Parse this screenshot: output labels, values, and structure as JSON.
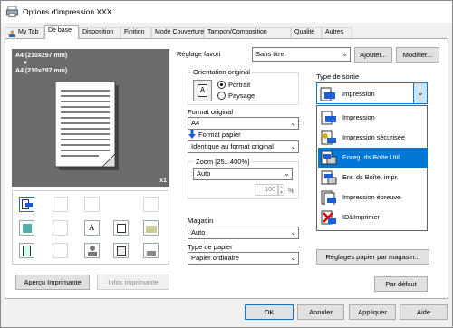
{
  "window": {
    "title": "Options d'impression XXX"
  },
  "tabs": [
    {
      "label": "My Tab"
    },
    {
      "label": "De base"
    },
    {
      "label": "Disposition"
    },
    {
      "label": "Finition"
    },
    {
      "label": "Mode Couverture"
    },
    {
      "label": "Tampon/Composition"
    },
    {
      "label": "Qualité"
    },
    {
      "label": "Autres"
    }
  ],
  "preview": {
    "paper_label_1": "A4 (210x297 mm)",
    "arrow_glyph": "▼",
    "paper_label_2": "A4 (210x297 mm)",
    "copies": "x1"
  },
  "bottom_left": {
    "printer_view_button": "Aperçu Imprimante",
    "printer_info_button": "Infos imprimante"
  },
  "favorites": {
    "label": "Réglage favori",
    "value": "Sans titre",
    "add_button": "Ajouter...",
    "edit_button": "Modifier..."
  },
  "orientation": {
    "title": "Orientation original",
    "portrait": "Portrait",
    "landscape": "Paysage",
    "selected": "Portrait"
  },
  "original_size": {
    "label": "Format original",
    "value": "A4"
  },
  "paper_size": {
    "label": "Format papier",
    "value": "Identique au format original"
  },
  "zoom": {
    "label": "Zoom [25...400%]",
    "mode_value": "Auto",
    "percent_value": "100",
    "unit": "%"
  },
  "paper_tray": {
    "label": "Magasin",
    "value": "Auto"
  },
  "paper_type": {
    "label": "Type de papier",
    "value": "Papier ordinaire"
  },
  "output_method": {
    "label": "Type de sortie",
    "value": "Impression",
    "options": [
      {
        "label": "Impression",
        "icon": "print-icon"
      },
      {
        "label": "Impression sécurisée",
        "icon": "secure-print-icon"
      },
      {
        "label": "Enreg. ds Boîte Util.",
        "icon": "save-to-box-icon"
      },
      {
        "label": "Enr. ds Boîte, impr.",
        "icon": "save-and-print-icon"
      },
      {
        "label": "Impression épreuve",
        "icon": "proof-print-icon"
      },
      {
        "label": "ID&Imprimer",
        "icon": "id-print-icon"
      }
    ],
    "highlighted_index": 2
  },
  "paper_settings_button": "Réglages papier par magasin...",
  "default_button": "Par défaut",
  "footer": {
    "ok": "OK",
    "cancel": "Annuler",
    "apply": "Appliquer",
    "help": "Aide"
  },
  "colors": {
    "accent": "#0078d7",
    "highlight": "#0078d7",
    "tab_bg": "#f0f0f0",
    "preview_bg": "#6b6b6b"
  }
}
